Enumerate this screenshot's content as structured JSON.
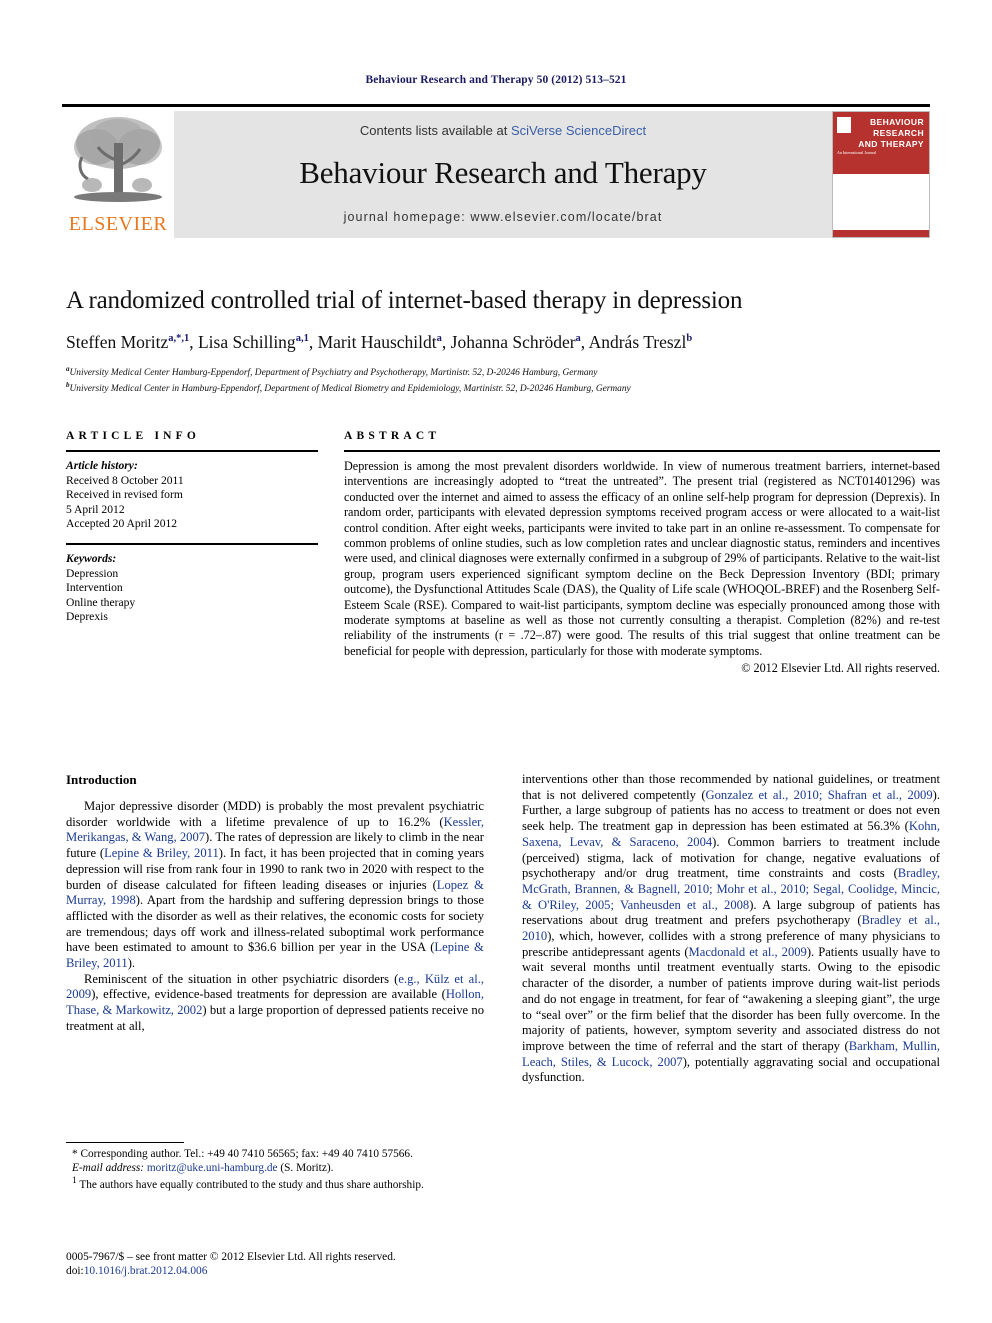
{
  "running_head": "Behaviour Research and Therapy 50 (2012) 513–521",
  "masthead": {
    "contents_prefix": "Contents lists available at ",
    "contents_link": "SciVerse ScienceDirect",
    "journal_title": "Behaviour Research and Therapy",
    "homepage": "journal homepage: www.elsevier.com/locate/brat",
    "publisher_wordmark": "ELSEVIER",
    "cover_title": "BEHAVIOUR RESEARCH AND THERAPY",
    "cover_subtitle": "An International Journal"
  },
  "title_block": {
    "title": "A randomized controlled trial of internet-based therapy in depression",
    "authors": [
      {
        "name": "Steffen Moritz",
        "marks": "a,*,1",
        "sep": ", "
      },
      {
        "name": "Lisa Schilling",
        "marks": "a,1",
        "sep": ", "
      },
      {
        "name": "Marit Hauschildt",
        "marks": "a",
        "sep": ", "
      },
      {
        "name": "Johanna Schröder",
        "marks": "a",
        "sep": ", "
      },
      {
        "name": "András Treszl",
        "marks": "b",
        "sep": ""
      }
    ],
    "affiliations": [
      {
        "mark": "a",
        "text": "University Medical Center Hamburg-Eppendorf, Department of Psychiatry and Psychotherapy, Martinistr. 52, D-20246 Hamburg, Germany"
      },
      {
        "mark": "b",
        "text": "University Medical Center in Hamburg-Eppendorf, Department of Medical Biometry and Epidemiology, Martinistr. 52, D-20246 Hamburg, Germany"
      }
    ]
  },
  "article_info": {
    "heading": "ARTICLE INFO",
    "history_label": "Article history:",
    "history_lines": [
      "Received 8 October 2011",
      "Received in revised form",
      "5 April 2012",
      "Accepted 20 April 2012"
    ],
    "keywords_label": "Keywords:",
    "keywords": [
      "Depression",
      "Intervention",
      "Online therapy",
      "Deprexis"
    ]
  },
  "abstract": {
    "heading": "ABSTRACT",
    "text": "Depression is among the most prevalent disorders worldwide. In view of numerous treatment barriers, internet-based interventions are increasingly adopted to “treat the untreated”. The present trial (registered as NCT01401296) was conducted over the internet and aimed to assess the efficacy of an online self-help program for depression (Deprexis). In random order, participants with elevated depression symptoms received program access or were allocated to a wait-list control condition. After eight weeks, participants were invited to take part in an online re-assessment. To compensate for common problems of online studies, such as low completion rates and unclear diagnostic status, reminders and incentives were used, and clinical diagnoses were externally confirmed in a subgroup of 29% of participants. Relative to the wait-list group, program users experienced significant symptom decline on the Beck Depression Inventory (BDI; primary outcome), the Dysfunctional Attitudes Scale (DAS), the Quality of Life scale (WHOQOL-BREF) and the Rosenberg Self-Esteem Scale (RSE). Compared to wait-list participants, symptom decline was especially pronounced among those with moderate symptoms at baseline as well as those not currently consulting a therapist. Completion (82%) and re-test reliability of the instruments (r = .72–.87) were good. The results of this trial suggest that online treatment can be beneficial for people with depression, particularly for those with moderate symptoms.",
    "copyright": "© 2012 Elsevier Ltd. All rights reserved."
  },
  "body": {
    "section_heading": "Introduction",
    "left_paragraphs": [
      "Major depressive disorder (MDD) is probably the most prevalent psychiatric disorder worldwide with a lifetime prevalence of up to 16.2% (Kessler, Merikangas, & Wang, 2007). The rates of depression are likely to climb in the near future (Lepine & Briley, 2011). In fact, it has been projected that in coming years depression will rise from rank four in 1990 to rank two in 2020 with respect to the burden of disease calculated for fifteen leading diseases or injuries (Lopez & Murray, 1998). Apart from the hardship and suffering depression brings to those afflicted with the disorder as well as their relatives, the economic costs for society are tremendous; days off work and illness-related suboptimal work performance have been estimated to amount to $36.6 billion per year in the USA (Lepine & Briley, 2011).",
      "Reminiscent of the situation in other psychiatric disorders (e.g., Külz et al., 2009), effective, evidence-based treatments for depression are available (Hollon, Thase, & Markowitz, 2002) but a large proportion of depressed patients receive no treatment at all,"
    ],
    "right_paragraphs": [
      "interventions other than those recommended by national guidelines, or treatment that is not delivered competently (Gonzalez et al., 2010; Shafran et al., 2009). Further, a large subgroup of patients has no access to treatment or does not even seek help. The treatment gap in depression has been estimated at 56.3% (Kohn, Saxena, Levav, & Saraceno, 2004). Common barriers to treatment include (perceived) stigma, lack of motivation for change, negative evaluations of psychotherapy and/or drug treatment, time constraints and costs (Bradley, McGrath, Brannen, & Bagnell, 2010; Mohr et al., 2010; Segal, Coolidge, Mincic, & O'Riley, 2005; Vanheusden et al., 2008). A large subgroup of patients has reservations about drug treatment and prefers psychotherapy (Bradley et al., 2010), which, however, collides with a strong preference of many physicians to prescribe antidepressant agents (Macdonald et al., 2009). Patients usually have to wait several months until treatment eventually starts. Owing to the episodic character of the disorder, a number of patients improve during wait-list periods and do not engage in treatment, for fear of “awakening a sleeping giant”, the urge to “seal over” or the firm belief that the disorder has been fully overcome. In the majority of patients, however, symptom severity and associated distress do not improve between the time of referral and the start of therapy (Barkham, Mullin, Leach, Stiles, & Lucock, 2007), potentially aggravating social and occupational dysfunction."
    ]
  },
  "footnotes": {
    "corresponding": "* Corresponding author. Tel.: +49 40 7410 56565; fax: +49 40 7410 57566.",
    "email_label": "E-mail address:",
    "email": "moritz@uke.uni-hamburg.de",
    "email_suffix": "(S. Moritz).",
    "note1_mark": "1",
    "note1": "The authors have equally contributed to the study and thus share authorship."
  },
  "imprint": {
    "line1": "0005-7967/$ – see front matter © 2012 Elsevier Ltd. All rights reserved.",
    "doi_label": "doi:",
    "doi": "10.1016/j.brat.2012.04.006"
  },
  "colors": {
    "link_blue": "#3b5fa8",
    "reference_blue": "#1a3a8f",
    "elsevier_orange": "#E87722",
    "cover_red": "#b5322e",
    "band_grey": "#e4e4e4"
  }
}
